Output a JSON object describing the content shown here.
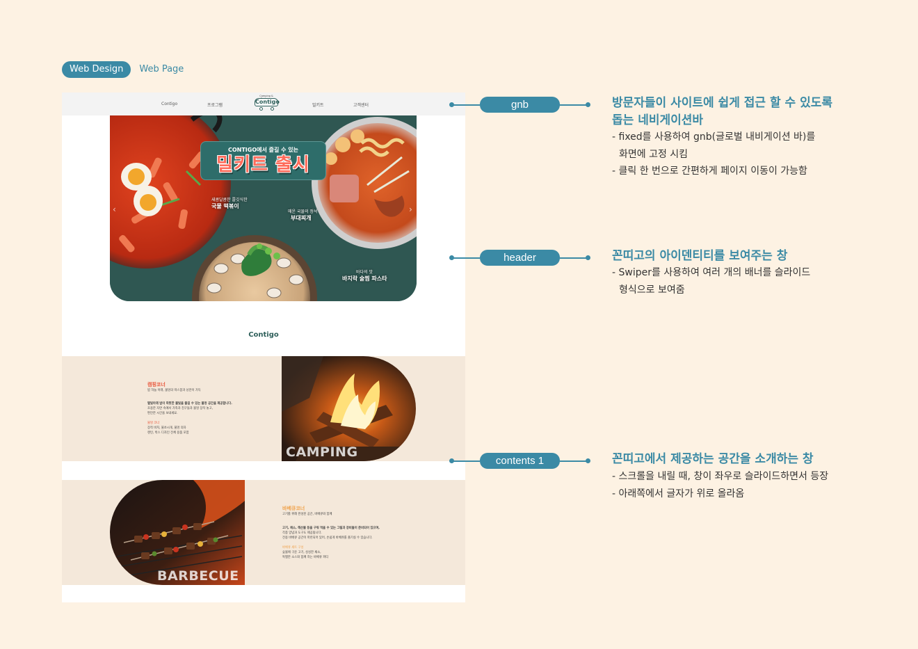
{
  "tabs": {
    "active": "Web Design",
    "other": "Web Page"
  },
  "site": {
    "gnb": {
      "items": [
        "Contigo",
        "프로그램",
        "밀키트",
        "고객센터"
      ],
      "logo": {
        "text": "Contigo",
        "tagline": "Camping & Barbecue"
      }
    },
    "hero": {
      "sub": "CONTIGO에서 즐길 수 있는",
      "main": "밀키트 출시",
      "captions": [
        {
          "small": "새콤달콤한 쫄깃식한",
          "big": "국물 떡볶이"
        },
        {
          "small": "매운 국물의 정석",
          "big": "부대찌개"
        },
        {
          "small": "바다의 맛",
          "big": "바지락 술찜 파스타"
        }
      ],
      "arrow_left": "‹",
      "arrow_right": "›"
    },
    "brand": "Contigo",
    "camping": {
      "title": "캠핑코너",
      "subtitle": "밤 하늘 아래, 불멍의 따스함과 낭만이 가득",
      "lines": [
        "별빛아래 밤이 따뜻한 불빛을 즐길 수 있는 불멍 공간을 제공합니다.",
        "조용한 자연 속에서 가족과 친구들과 불멍 장작 놓고,",
        "편안한 시간을 보내세요."
      ],
      "accent": "불멍 코너",
      "extra": [
        "장작 비치, 불쏘시개, 불멍 의자",
        "랜턴, 박스 디자인 전체 용품 포함"
      ],
      "word": "CAMPING"
    },
    "barbecue": {
      "title": "바베큐코너",
      "subtitle": "고기를 위해 완성된 공간, 바베큐와 함께",
      "lines": [
        "고기, 채소, 해산물 등을 구워 먹을 수 있는 그릴과 장비들이 준비되어 있으며,",
        "각종 양념과 도구도 제공됩니다.",
        "전용 바베큐 공간이 마련되어 있어, 손쉽게 바베큐를 즐기실 수 있습니다."
      ],
      "accent": "바베큐 세트 구성",
      "extra": [
        "숯불에 구운 고기, 싱싱한 채소,",
        "특별한 소스와 함께 하는 바베큐 파티"
      ],
      "word": "BARBECUE"
    }
  },
  "annotations": [
    {
      "pill": "gnb",
      "title": [
        "방문자들이 사이트에 쉽게 접근 할 수 있도록",
        "돕는 네비게이션바"
      ],
      "lines": [
        "- fixed를 사용하여 gnb(글로벌 내비게이션 바)를",
        "  화면에 고정 시킴",
        "- 클릭 한 번으로 간편하게 페이지 이동이 가능함"
      ]
    },
    {
      "pill": "header",
      "title": [
        "꼰띠고의  아이덴티티를  보여주는 창"
      ],
      "lines": [
        "- Swiper를 사용하여 여러 개의 배너를 슬라이드",
        "  형식으로 보여줌"
      ]
    },
    {
      "pill": "contents 1",
      "title": [
        "꼰띠고에서 제공하는  공간을 소개하는 창"
      ],
      "lines": [
        "- 스크롤을 내릴 때, 창이 좌우로 슬라이드하면서 등장",
        "- 아래쪽에서 글자가 위로 올라옴"
      ]
    }
  ],
  "colors": {
    "accent": "#3b8aa5",
    "background": "#fdf2e3",
    "brand": "#2e5f5a",
    "camping_title": "#e8563b",
    "barbecue_title": "#f0a24a"
  },
  "icons": [
    "chevron-left-icon",
    "chevron-right-icon",
    "connector-dot-icon"
  ]
}
